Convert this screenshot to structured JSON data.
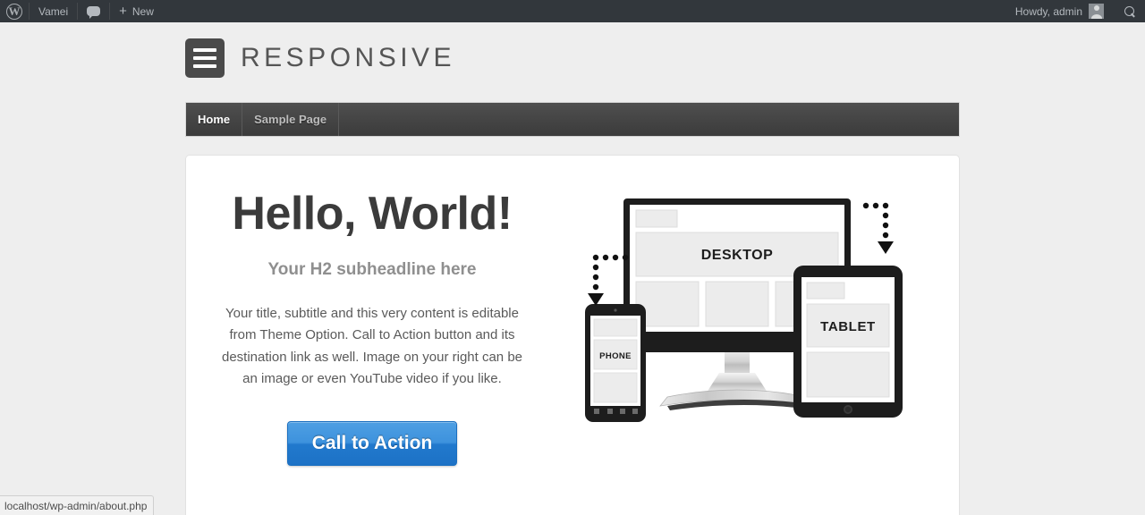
{
  "adminbar": {
    "wp_logo_glyph": "W",
    "site_name": "Vamei",
    "comments_label": "",
    "new_label": "New",
    "new_plus": "+",
    "howdy": "Howdy, admin",
    "icons": {
      "wordpress": "wordpress-icon",
      "comment": "comment-bubble-icon",
      "plus": "plus-icon",
      "avatar": "avatar-icon",
      "search": "search-icon"
    },
    "bg_color": "#32373c",
    "text_color": "#b4b9be"
  },
  "header": {
    "logo_icon": "hamburger-logo-icon",
    "site_title": "RESPONSIVE"
  },
  "nav": {
    "items": [
      {
        "label": "Home",
        "active": true
      },
      {
        "label": "Sample Page",
        "active": false
      }
    ]
  },
  "main": {
    "headline": "Hello, World!",
    "subheadline": "Your H2 subheadline here",
    "paragraph": "Your title, subtitle and this very content is editable from Theme Option. Call to Action button and its destination link as well. Image on your right can be an image or even YouTube video if you like.",
    "cta_button_label": "Call to Action",
    "cta_button_color": "#3d92dd"
  },
  "illustration": {
    "desktop_label": "DESKTOP",
    "tablet_label": "TABLET",
    "phone_label": "PHONE",
    "alt": "responsive-devices-illustration"
  },
  "statusbar": {
    "url": "localhost/wp-admin/about.php"
  }
}
